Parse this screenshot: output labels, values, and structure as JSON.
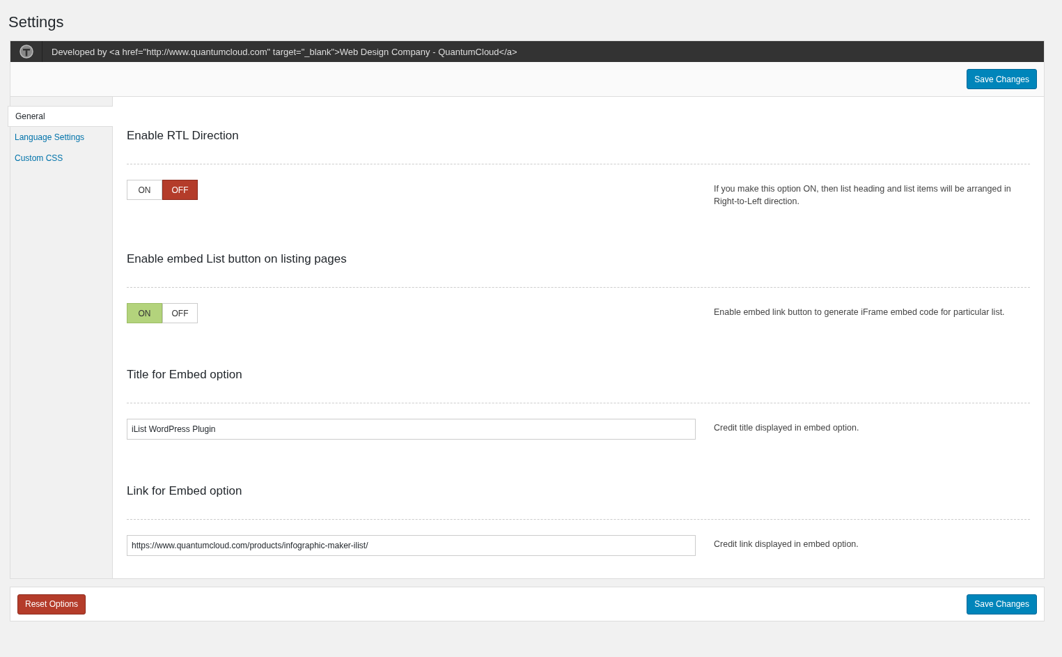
{
  "page_title": "Settings",
  "header_bar": {
    "text": "Developed by <a href=\"http://www.quantumcloud.com\" target=\"_blank\">Web Design Company - QuantumCloud</a>"
  },
  "top_button": "Save Changes",
  "sidebar": {
    "items": [
      {
        "label": "General",
        "selected": true
      },
      {
        "label": "Language Settings",
        "selected": false
      },
      {
        "label": "Custom CSS",
        "selected": false
      }
    ]
  },
  "sections": [
    {
      "title": "Enable RTL Direction",
      "kind": "toggle",
      "options": [
        {
          "label": "ON",
          "selected": false
        },
        {
          "label": "OFF",
          "selected": true
        }
      ],
      "description": "If you make this option ON, then list heading and list items will be arranged in Right-to-Left direction."
    },
    {
      "title": "Enable embed List button on listing pages",
      "kind": "toggle",
      "options": [
        {
          "label": "ON",
          "selected": true
        },
        {
          "label": "OFF",
          "selected": false
        }
      ],
      "description": "Enable embed link button to generate iFrame embed code for particular list."
    },
    {
      "title": "Title for Embed option",
      "kind": "text",
      "value": "iList WordPress Plugin",
      "description": "Credit title displayed in embed option."
    },
    {
      "title": "Link for Embed option",
      "kind": "text",
      "value": "https://www.quantumcloud.com/products/infographic-maker-ilist/",
      "description": "Credit link displayed in embed option."
    }
  ],
  "footer": {
    "reset_button": "Reset Options",
    "save_button": "Save Changes"
  }
}
